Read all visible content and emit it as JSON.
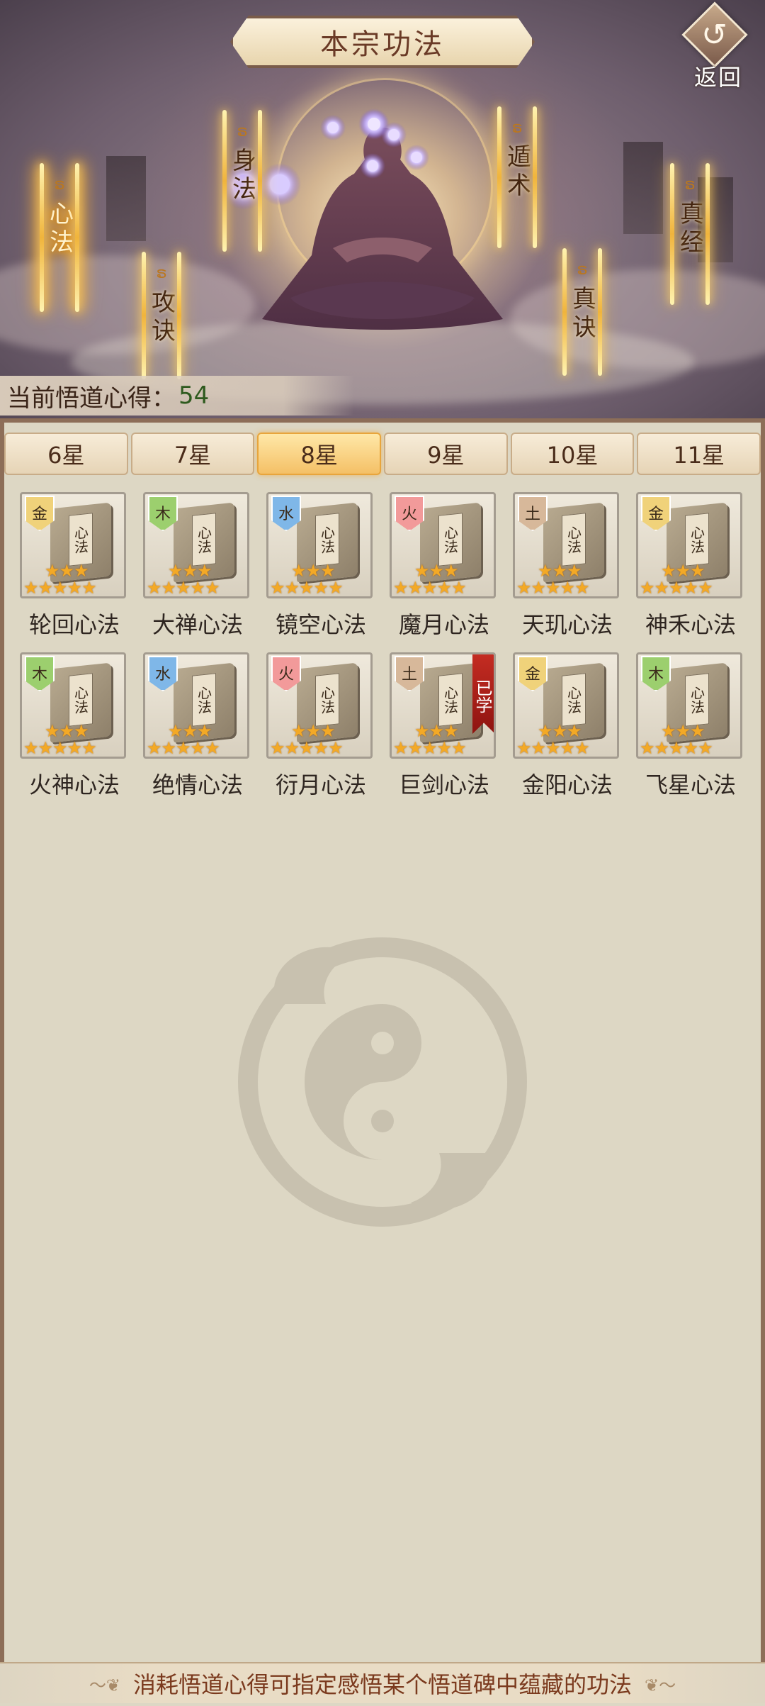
{
  "header": {
    "title": "本宗功法",
    "back_label": "返回"
  },
  "categories": [
    {
      "label": "心法",
      "active": true
    },
    {
      "label": "身法",
      "active": false
    },
    {
      "label": "攻诀",
      "active": false
    },
    {
      "label": "遁术",
      "active": false
    },
    {
      "label": "真诀",
      "active": false
    },
    {
      "label": "真经",
      "active": false
    }
  ],
  "insight": {
    "label": "当前悟道心得：",
    "value": "54"
  },
  "tabs": [
    {
      "label": "6星",
      "active": false
    },
    {
      "label": "7星",
      "active": false
    },
    {
      "label": "8星",
      "active": true
    },
    {
      "label": "9星",
      "active": false
    },
    {
      "label": "10星",
      "active": false
    },
    {
      "label": "11星",
      "active": false
    }
  ],
  "manual_cover_text": "心法",
  "manuals": [
    {
      "name": "轮回心法",
      "element": "金",
      "stars": 8,
      "learned": false
    },
    {
      "name": "大禅心法",
      "element": "木",
      "stars": 8,
      "learned": false
    },
    {
      "name": "镜空心法",
      "element": "水",
      "stars": 8,
      "learned": false
    },
    {
      "name": "魔月心法",
      "element": "火",
      "stars": 8,
      "learned": false
    },
    {
      "name": "天玑心法",
      "element": "土",
      "stars": 8,
      "learned": false
    },
    {
      "name": "神禾心法",
      "element": "金",
      "stars": 8,
      "learned": false
    },
    {
      "name": "火神心法",
      "element": "木",
      "stars": 8,
      "learned": false
    },
    {
      "name": "绝情心法",
      "element": "水",
      "stars": 8,
      "learned": false
    },
    {
      "name": "衍月心法",
      "element": "火",
      "stars": 8,
      "learned": false
    },
    {
      "name": "巨剑心法",
      "element": "土",
      "stars": 8,
      "learned": true,
      "learned_label": "已学"
    },
    {
      "name": "金阳心法",
      "element": "金",
      "stars": 8,
      "learned": false
    },
    {
      "name": "飞星心法",
      "element": "木",
      "stars": 8,
      "learned": false
    }
  ],
  "element_colors": {
    "金": "#f0d27a",
    "木": "#9ccf6e",
    "水": "#7fb7e8",
    "火": "#f29a9a",
    "土": "#d7b89a"
  },
  "footer": {
    "tip": "消耗悟道心得可指定感悟某个悟道碑中蕴藏的功法"
  }
}
